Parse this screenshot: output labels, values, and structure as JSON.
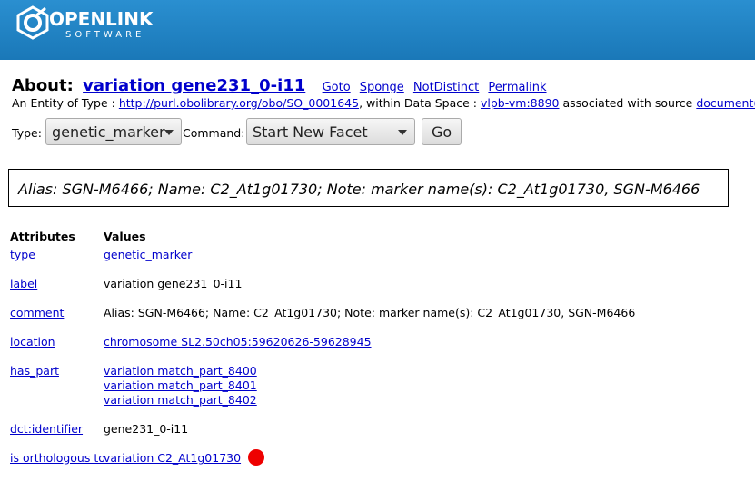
{
  "header": {
    "logo_top": "OPENLINK",
    "logo_bottom": "SOFTWARE",
    "bg_color": "#1f84c4"
  },
  "about": {
    "prefix": "About:",
    "subject": "variation gene231_0-i11",
    "actions": [
      "Goto",
      "Sponge",
      "NotDistinct",
      "Permalink"
    ]
  },
  "entity": {
    "prefix": "An Entity of Type :",
    "type_link": "http://purl.obolibrary.org/obo/SO_0001645",
    "middle": ", within Data Space :",
    "space_link": "vlpb-vm:8890",
    "suffix": "associated with source",
    "source_link": "document(s)"
  },
  "form": {
    "type_label": "Type:",
    "type_value": "genetic_marker",
    "command_label": "Command:",
    "command_value": "Start New Facet",
    "go_label": "Go"
  },
  "summary": "Alias: SGN-M6466; Name: C2_At1g01730; Note: marker name(s): C2_At1g01730, SGN-M6466",
  "table": {
    "headers": [
      "Attributes",
      "Values"
    ],
    "rows": [
      {
        "attr": "type",
        "values": [
          "genetic_marker"
        ],
        "link": true
      },
      {
        "attr": "label",
        "values": [
          "variation gene231_0-i11"
        ],
        "link": false
      },
      {
        "attr": "comment",
        "values": [
          "Alias: SGN-M6466; Name: C2_At1g01730; Note: marker name(s): C2_At1g01730, SGN-M6466"
        ],
        "link": false
      },
      {
        "attr": "location",
        "values": [
          "chromosome SL2.50ch05:59620626-59628945"
        ],
        "link": true
      },
      {
        "attr": "has_part",
        "values": [
          "variation match_part_8400",
          "variation match_part_8401",
          "variation match_part_8402"
        ],
        "link": true
      },
      {
        "attr": "dct:identifier",
        "values": [
          "gene231_0-i11"
        ],
        "link": false
      },
      {
        "attr": "is orthologous to",
        "values": [
          "variation C2_At1g01730"
        ],
        "link": true,
        "red_dot": true
      }
    ]
  }
}
